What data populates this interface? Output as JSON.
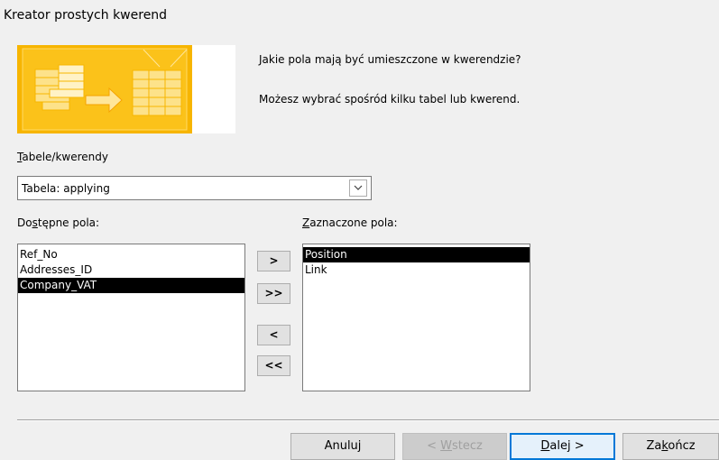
{
  "window": {
    "title": "Kreator prostych kwerend"
  },
  "header": {
    "question": "Jakie pola mają być umieszczone w kwerendzie?",
    "hint": "Możesz wybrać spośród kilku tabel lub kwerend."
  },
  "tables": {
    "label_accel": "T",
    "label_rest": "abele/kwerendy",
    "selected": "Tabela: applying"
  },
  "available": {
    "label_pre": "Do",
    "label_accel": "s",
    "label_post": "tępne pola:",
    "items": [
      "Ref_No",
      "Addresses_ID",
      "Company_VAT"
    ],
    "selected_index": 2
  },
  "chosen": {
    "label_accel": "Z",
    "label_rest": "aznaczone pola:",
    "items": [
      "Position",
      "Link"
    ],
    "selected_index": 0
  },
  "move_buttons": {
    "add_one": ">",
    "add_all": ">>",
    "remove_one": "<",
    "remove_all": "<<"
  },
  "footer": {
    "cancel": "Anuluj",
    "back_pre": "< ",
    "back_accel": "W",
    "back_post": "stecz",
    "next_accel": "D",
    "next_post": "alej >",
    "finish_pre": "Za",
    "finish_accel": "k",
    "finish_post": "ończ"
  }
}
